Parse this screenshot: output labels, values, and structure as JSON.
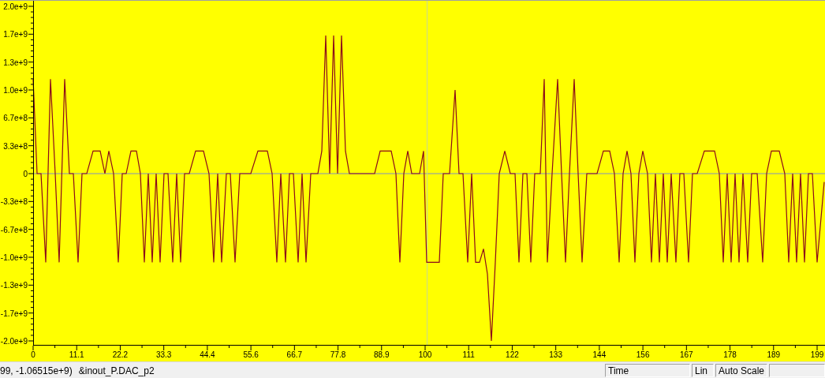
{
  "plot": {
    "y_ticks": [
      "2.0e+9",
      "1.7e+9",
      "1.3e+9",
      "1.0e+9",
      "6.7e+8",
      "3.3e+8",
      "0",
      "-3.3e+8",
      "-6.7e+8",
      "-1.0e+9",
      "-1.3e+9",
      "-1.7e+9",
      "-2.0e+9"
    ],
    "x_ticks": [
      "0",
      "11.1",
      "22.2",
      "33.3",
      "44.4",
      "55.6",
      "66.7",
      "77.8",
      "88.9",
      "100",
      "111",
      "122",
      "133",
      "144",
      "156",
      "167",
      "178",
      "189",
      "199"
    ]
  },
  "status_bar": {
    "cursor_readout": "99, -1.06515e+9)",
    "signal": "&inout_P.DAC_p2",
    "x_axis": "Time",
    "scale_type": "Lin",
    "scale_mode": "Auto Scale"
  }
}
